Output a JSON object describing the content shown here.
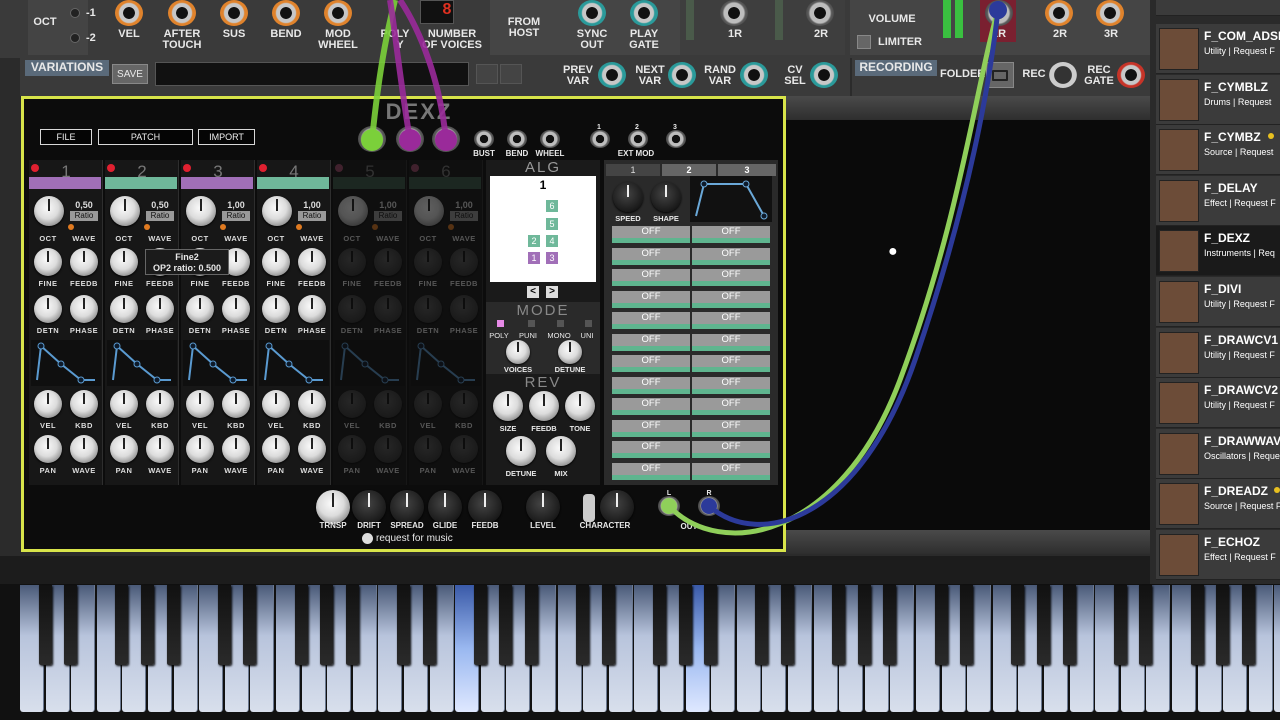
{
  "top_bar": {
    "oct_label": "OCT",
    "oct_minus1": "-1",
    "oct_minus2": "-2",
    "vel": "VEL",
    "after_touch": "AFTER\nTOUCH",
    "sus": "SUS",
    "bend": "BEND",
    "mod_wheel": "MOD\nWHEEL",
    "poly": "POLY",
    "poly_sub": "Y",
    "number_of_voices": "NUMBER\nOF VOICES",
    "from_host": "FROM\nHOST",
    "sync_out": "SYNC\nOUT",
    "play_gate": "PLAY\nGATE",
    "in_1r": "1R",
    "in_2r": "2R",
    "volume": "VOLUME",
    "limiter": "LIMITER",
    "out_1r": "1R",
    "out_2r": "2R",
    "out_3r": "3R",
    "voices_display": "8"
  },
  "variations": {
    "title": "VARIATIONS",
    "save": "SAVE",
    "prev_var": "PREV\nVAR",
    "next_var": "NEXT\nVAR",
    "rand_var": "RAND\nVAR",
    "cv_sel": "CV\nSEL"
  },
  "recording": {
    "title": "RECORDING",
    "folder": "FOLDER",
    "rec": "REC",
    "rec_gate": "REC\nGATE"
  },
  "synth": {
    "name": "DEXZ",
    "file_btn": "FILE",
    "patch_btn": "PATCH",
    "import_btn": "IMPORT",
    "bust": "BUST",
    "bend": "BEND",
    "wheel": "WHEEL",
    "ext_mod": "EXT MOD",
    "ext_mod_nums": [
      "1",
      "2",
      "3"
    ],
    "operators": [
      {
        "num": "1",
        "ratio_val": "0,50",
        "ratio": "Ratio",
        "color": "#a16fb8"
      },
      {
        "num": "2",
        "ratio_val": "0,50",
        "ratio": "Ratio",
        "color": "#6fb89a"
      },
      {
        "num": "3",
        "ratio_val": "1,00",
        "ratio": "Ratio",
        "color": "#a16fb8"
      },
      {
        "num": "4",
        "ratio_val": "1,00",
        "ratio": "Ratio",
        "color": "#6fb89a"
      },
      {
        "num": "5",
        "ratio_val": "1,00",
        "ratio": "Ratio",
        "color": "#3a5a4a"
      },
      {
        "num": "6",
        "ratio_val": "1,00",
        "ratio": "Ratio",
        "color": "#3a5a4a"
      }
    ],
    "op_labels": {
      "oct": "OCT",
      "wave": "WAVE",
      "fine": "FINE",
      "feedb": "FEEDB",
      "detn": "DETN",
      "phase": "PHASE",
      "vel": "VEL",
      "kbd": "KBD",
      "pan": "PAN"
    },
    "tooltip": {
      "title": "Fine2",
      "text": "OP2 ratio: 0.500"
    },
    "alg": {
      "title": "ALG",
      "number": "1",
      "boxes": [
        "6",
        "5",
        "2",
        "4",
        "1",
        "3"
      ],
      "prev": "<",
      "next": ">"
    },
    "mode": {
      "title": "MODE",
      "poly": "POLY",
      "puni": "PUNI",
      "mono": "MONO",
      "uni": "UNI",
      "voices": "VOICES",
      "detune": "DETUNE"
    },
    "rev": {
      "title": "REV",
      "size": "SIZE",
      "feedb": "FEEDB",
      "tone": "TONE",
      "detune": "DETUNE",
      "mix": "MIX"
    },
    "lfo": {
      "tabs": [
        "1",
        "2",
        "3"
      ],
      "speed": "SPEED",
      "shape": "SHAPE"
    },
    "matrix": [
      "OFF",
      "OFF",
      "OFF",
      "OFF",
      "OFF",
      "OFF",
      "OFF",
      "OFF",
      "OFF",
      "OFF",
      "OFF",
      "OFF",
      "OFF",
      "OFF",
      "OFF",
      "OFF",
      "OFF",
      "OFF",
      "OFF",
      "OFF",
      "OFF",
      "OFF",
      "OFF",
      "OFF"
    ],
    "bottom": {
      "trnsp": "TRNSP",
      "drift": "DRIFT",
      "spread": "SPREAD",
      "glide": "GLIDE",
      "feedb": "FEEDB",
      "level": "LEVEL",
      "character": "CHARACTER",
      "out": "OUT",
      "l": "L",
      "r": "R",
      "brand": "request for music"
    }
  },
  "library": [
    {
      "name": "F_COM_ADSR",
      "cat": "Utility  |  Request F",
      "dot": false
    },
    {
      "name": "F_CYMBLZ",
      "cat": "Drums  |  Request",
      "dot": false
    },
    {
      "name": "F_CYMBZ",
      "cat": "Source  |  Request",
      "dot": true
    },
    {
      "name": "F_DELAY",
      "cat": "Effect  |  Request F",
      "dot": false
    },
    {
      "name": "F_DEXZ",
      "cat": "Instruments  |  Req",
      "dot": false
    },
    {
      "name": "F_DIVI",
      "cat": "Utility  |  Request F",
      "dot": false
    },
    {
      "name": "F_DRAWCV1",
      "cat": "Utility  |  Request F",
      "dot": false
    },
    {
      "name": "F_DRAWCV2",
      "cat": "Utility  |  Request F",
      "dot": false
    },
    {
      "name": "F_DRAWWAV",
      "cat": "Oscillators  |  Reque",
      "dot": false
    },
    {
      "name": "F_DREADZ",
      "cat": "Source  |  Request F",
      "dot": true
    },
    {
      "name": "F_ECHOZ",
      "cat": "Effect  |  Request F",
      "dot": false
    }
  ],
  "colors": {
    "selected_border": "#d8e44a",
    "cable_green": "#8fcf5a",
    "cable_blue": "#2c3a9a",
    "cable_purple": "#9a2a9a",
    "matrix_green": "#5fb58f"
  }
}
